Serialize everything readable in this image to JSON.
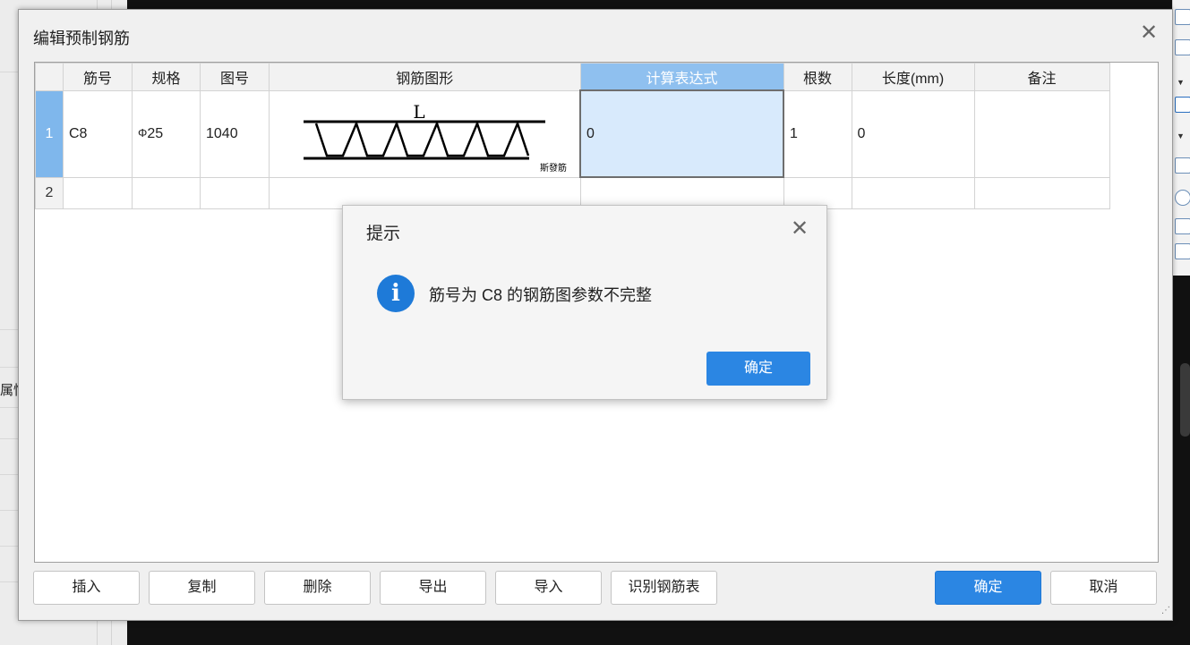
{
  "background": {
    "left_panel_label": "属性"
  },
  "dialog": {
    "title": "编辑预制钢筋",
    "close_glyph": "✕",
    "table": {
      "headers": {
        "rownum": "",
        "bar_no": "筋号",
        "spec": "规格",
        "figure_no": "图号",
        "shape": "钢筋图形",
        "formula": "计算表达式",
        "count": "根数",
        "length": "长度(mm)",
        "remark": "备注"
      },
      "rows": [
        {
          "num": "1",
          "bar_no": "C8",
          "spec_symbol": "Φ",
          "spec_value": "25",
          "figure_no": "1040",
          "shape_top_label": "L",
          "shape_bottom_label": "斯發筋",
          "formula": "0",
          "count": "1",
          "length": "0",
          "remark": ""
        },
        {
          "num": "2",
          "bar_no": "",
          "spec_symbol": "",
          "spec_value": "",
          "figure_no": "",
          "formula": "",
          "count": "",
          "length": "",
          "remark": ""
        }
      ]
    },
    "buttons": {
      "insert": "插入",
      "copy": "复制",
      "delete": "删除",
      "export": "导出",
      "import": "导入",
      "recognize": "识别钢筋表",
      "ok": "确定",
      "cancel": "取消"
    },
    "resize_grip": "⋰"
  },
  "message_box": {
    "title": "提示",
    "close_glyph": "✕",
    "icon": "i",
    "text": "筋号为 C8 的钢筋图参数不完整",
    "ok_label": "确定"
  },
  "colors": {
    "accent": "#2b86e3",
    "selected_header": "#8fc0ef",
    "selected_cell": "#d8eafc",
    "info_icon": "#1e7ad8"
  }
}
